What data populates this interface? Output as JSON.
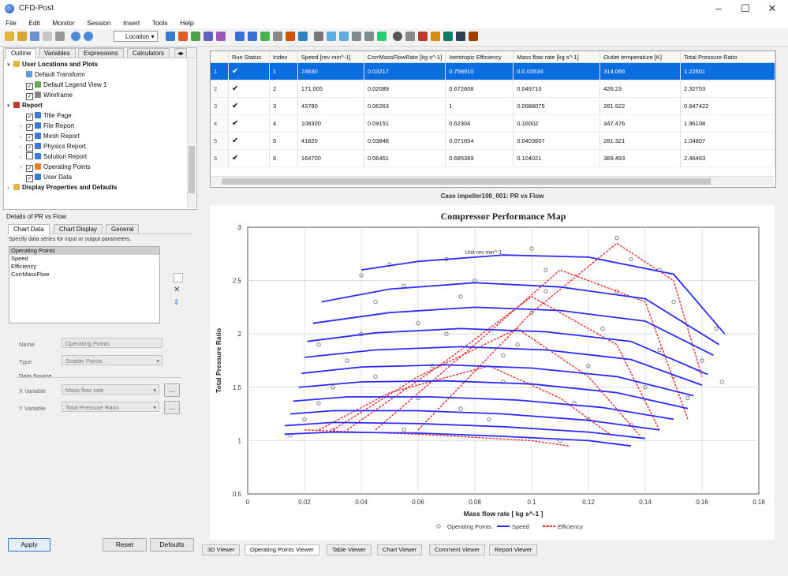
{
  "window": {
    "title": "CFD-Post",
    "controls": [
      "–",
      "☐",
      "✕"
    ]
  },
  "menu": [
    "File",
    "Edit",
    "Monitor",
    "Session",
    "Insert",
    "Tools",
    "Help"
  ],
  "toolbar": {
    "location_label": "Location"
  },
  "outline": {
    "tabs": [
      "Outline",
      "Variables",
      "Expressions",
      "Calculators"
    ],
    "items": [
      {
        "label": "User Locations and Plots",
        "level": 0,
        "bold": true,
        "expander": "▾",
        "icon": "folder-icon"
      },
      {
        "label": "Default Transform",
        "level": 1,
        "icon": "transform-icon"
      },
      {
        "label": "Default Legend View 1",
        "level": 1,
        "icon": "legend-icon",
        "checkbox": true
      },
      {
        "label": "Wireframe",
        "level": 1,
        "icon": "wireframe-icon",
        "checkbox": true
      },
      {
        "label": "Report",
        "level": 0,
        "bold": true,
        "expander": "▾",
        "icon": "report-icon"
      },
      {
        "label": "Title Page",
        "level": 1,
        "icon": "page-icon",
        "checkbox": true
      },
      {
        "label": "File Report",
        "level": 1,
        "icon": "page-icon",
        "checkbox": true,
        "expander": "›"
      },
      {
        "label": "Mesh Report",
        "level": 1,
        "icon": "page-icon",
        "checkbox": true,
        "expander": "›"
      },
      {
        "label": "Physics Report",
        "level": 1,
        "icon": "page-icon",
        "checkbox": true,
        "expander": "›"
      },
      {
        "label": "Solution Report",
        "level": 1,
        "icon": "page-icon",
        "checkbox": false,
        "expander": "›"
      },
      {
        "label": "Operating Points",
        "level": 1,
        "icon": "chart-icon",
        "checkbox": true,
        "expander": "›"
      },
      {
        "label": "User Data",
        "level": 1,
        "icon": "page-icon",
        "checkbox": true
      },
      {
        "label": "Display Properties and Defaults",
        "level": 0,
        "bold": true,
        "expander": "›",
        "icon": "folder-icon"
      }
    ]
  },
  "details": {
    "header": "Details of PR vs Flow",
    "tabs": [
      "Chart Data",
      "Chart Display",
      "General"
    ],
    "instruction": "Specify data series for input or output parameters.",
    "series_list": [
      "Operating Points",
      "Speed",
      "Efficiency",
      "CorrMassFlow"
    ],
    "name_label": "Name",
    "name_value": "Operating Points",
    "type_label": "Type",
    "type_value": "Scatter Points",
    "data_source_label": "Data Source",
    "xvar_label": "X Variable",
    "xvar_value": "Mass flow rate",
    "yvar_label": "Y Variable",
    "yvar_value": "Total Pressure Ratio",
    "more_button": "...",
    "buttons": {
      "apply": "Apply",
      "reset": "Reset",
      "defaults": "Defaults"
    }
  },
  "table": {
    "columns": [
      "",
      "Run Status",
      "Index",
      "Speed [rev min^-1]",
      "CorrMassFlowRate [kg s^-1]",
      "Isentropic Efficiency",
      "Mass flow rate [kg s^-1]",
      "Outlet temperature [K]",
      "Total Pressure Ratio"
    ],
    "rows": [
      {
        "n": "1",
        "status": "✔",
        "index": "1",
        "speed": "74630",
        "corr": "0.03217",
        "eff": "0.758910",
        "mfr": "0.0.03534",
        "temp": "314.066",
        "tpr": "1.22601"
      },
      {
        "n": "2",
        "status": "✔",
        "index": "2",
        "speed": "171,005",
        "corr": "0.02089",
        "eff": "0.672608",
        "mfr": "0.049710",
        "temp": "426.23",
        "tpr": "2.32753"
      },
      {
        "n": "3",
        "status": "✔",
        "index": "3",
        "speed": "43780",
        "corr": "0.06263",
        "eff": "1",
        "mfr": "0.0688075",
        "temp": "281.922",
        "tpr": "0.947422"
      },
      {
        "n": "4",
        "status": "✔",
        "index": "4",
        "speed": "108300",
        "corr": "0.09151",
        "eff": "0.62304",
        "mfr": "0.16002",
        "temp": "347.476",
        "tpr": "1.96108"
      },
      {
        "n": "5",
        "status": "✔",
        "index": "5",
        "speed": "41820",
        "corr": "0.03848",
        "eff": "0.071654",
        "mfr": "0.0403607",
        "temp": "281.321",
        "tpr": "1.04807"
      },
      {
        "n": "6",
        "status": "✔",
        "index": "6",
        "speed": "164700",
        "corr": "0.06451",
        "eff": "0.685389",
        "mfr": "0.104021",
        "temp": "369.493",
        "tpr": "2.46463"
      }
    ]
  },
  "chart_caption": "Case impeller100_001: PR vs Flow",
  "chart_data": {
    "type": "line",
    "title": "Compressor Performance Map",
    "xlabel": "Mass flow rate [ kg s^-1 ]",
    "ylabel": "Total Pressure Ratio",
    "xlim": [
      0,
      0.18
    ],
    "ylim": [
      0.5,
      3
    ],
    "xticks": [
      "0",
      "0.02",
      "0.04",
      "0.06",
      "0.08",
      "0.1",
      "0.12",
      "0.14",
      "0.16",
      "0.18"
    ],
    "yticks": [
      "0.5",
      "1",
      "1.5",
      "2",
      "2.5",
      "3"
    ],
    "annotation": "Unit rev min^-1",
    "grid": true,
    "legend_position": "bottom",
    "legend": [
      {
        "name": "Operating Points",
        "color": "#888888"
      },
      {
        "name": "Speed",
        "color": "#2b2bff"
      },
      {
        "name": "Efficiency",
        "color": "#ee2222"
      }
    ],
    "speed_lines": [
      {
        "x": [
          0.013,
          0.03,
          0.06,
          0.09,
          0.12,
          0.135
        ],
        "y": [
          1.06,
          1.08,
          1.07,
          1.04,
          1.0,
          0.95
        ]
      },
      {
        "x": [
          0.013,
          0.03,
          0.06,
          0.09,
          0.12,
          0.14
        ],
        "y": [
          1.14,
          1.17,
          1.16,
          1.13,
          1.08,
          1.02
        ]
      },
      {
        "x": [
          0.015,
          0.03,
          0.06,
          0.09,
          0.12,
          0.145
        ],
        "y": [
          1.25,
          1.28,
          1.28,
          1.25,
          1.19,
          1.1
        ]
      },
      {
        "x": [
          0.016,
          0.035,
          0.065,
          0.095,
          0.125,
          0.15
        ],
        "y": [
          1.37,
          1.41,
          1.41,
          1.38,
          1.31,
          1.2
        ]
      },
      {
        "x": [
          0.018,
          0.04,
          0.07,
          0.1,
          0.13,
          0.155
        ],
        "y": [
          1.5,
          1.55,
          1.56,
          1.53,
          1.45,
          1.3
        ]
      },
      {
        "x": [
          0.019,
          0.04,
          0.07,
          0.1,
          0.13,
          0.157
        ],
        "y": [
          1.63,
          1.69,
          1.71,
          1.68,
          1.6,
          1.42
        ]
      },
      {
        "x": [
          0.02,
          0.045,
          0.075,
          0.105,
          0.135,
          0.16
        ],
        "y": [
          1.78,
          1.85,
          1.88,
          1.85,
          1.76,
          1.52
        ]
      },
      {
        "x": [
          0.021,
          0.045,
          0.075,
          0.105,
          0.135,
          0.162
        ],
        "y": [
          1.93,
          2.01,
          2.05,
          2.02,
          1.93,
          1.62
        ]
      },
      {
        "x": [
          0.023,
          0.05,
          0.08,
          0.11,
          0.14,
          0.164
        ],
        "y": [
          2.1,
          2.2,
          2.25,
          2.22,
          2.12,
          1.8
        ]
      },
      {
        "x": [
          0.026,
          0.05,
          0.08,
          0.11,
          0.14,
          0.166
        ],
        "y": [
          2.3,
          2.42,
          2.48,
          2.44,
          2.33,
          1.9
        ]
      },
      {
        "x": [
          0.04,
          0.06,
          0.09,
          0.12,
          0.15,
          0.168
        ],
        "y": [
          2.6,
          2.68,
          2.74,
          2.72,
          2.56,
          2.0
        ]
      }
    ],
    "efficiency_lines": [
      {
        "x": [
          0.02,
          0.06,
          0.1,
          0.113
        ],
        "y": [
          1.1,
          1.06,
          1.0,
          0.95
        ]
      },
      {
        "x": [
          0.025,
          0.05,
          0.085,
          0.11,
          0.128
        ],
        "y": [
          1.1,
          1.45,
          1.7,
          1.4,
          1.05
        ]
      },
      {
        "x": [
          0.03,
          0.06,
          0.095,
          0.12,
          0.138
        ],
        "y": [
          1.1,
          1.6,
          2.05,
          1.6,
          1.05
        ]
      },
      {
        "x": [
          0.035,
          0.07,
          0.1,
          0.13,
          0.145
        ],
        "y": [
          1.1,
          1.75,
          2.35,
          1.9,
          1.1
        ]
      },
      {
        "x": [
          0.045,
          0.08,
          0.11,
          0.14,
          0.155
        ],
        "y": [
          1.1,
          1.9,
          2.6,
          2.3,
          1.2
        ]
      },
      {
        "x": [
          0.06,
          0.1,
          0.13,
          0.15,
          0.16
        ],
        "y": [
          1.1,
          2.2,
          2.85,
          2.5,
          1.6
        ]
      }
    ],
    "operating_points": [
      [
        0.015,
        1.05
      ],
      [
        0.02,
        1.2
      ],
      [
        0.025,
        1.35
      ],
      [
        0.03,
        1.5
      ],
      [
        0.035,
        1.75
      ],
      [
        0.04,
        2.0
      ],
      [
        0.045,
        2.3
      ],
      [
        0.05,
        2.65
      ],
      [
        0.055,
        1.1
      ],
      [
        0.06,
        1.4
      ],
      [
        0.065,
        1.7
      ],
      [
        0.07,
        2.0
      ],
      [
        0.075,
        2.35
      ],
      [
        0.08,
        2.5
      ],
      [
        0.085,
        1.2
      ],
      [
        0.09,
        1.55
      ],
      [
        0.095,
        1.9
      ],
      [
        0.1,
        2.2
      ],
      [
        0.105,
        2.6
      ],
      [
        0.11,
        1.0
      ],
      [
        0.115,
        1.35
      ],
      [
        0.12,
        1.7
      ],
      [
        0.125,
        2.05
      ],
      [
        0.13,
        2.4
      ],
      [
        0.135,
        1.15
      ],
      [
        0.14,
        1.5
      ],
      [
        0.145,
        1.85
      ],
      [
        0.15,
        2.3
      ],
      [
        0.155,
        1.4
      ],
      [
        0.16,
        1.75
      ],
      [
        0.165,
        2.05
      ],
      [
        0.167,
        1.55
      ],
      [
        0.03,
        1.1
      ],
      [
        0.045,
        1.6
      ],
      [
        0.06,
        2.1
      ],
      [
        0.075,
        1.3
      ],
      [
        0.09,
        1.8
      ],
      [
        0.105,
        2.4
      ],
      [
        0.12,
        1.2
      ],
      [
        0.135,
        2.7
      ],
      [
        0.15,
        1.6
      ],
      [
        0.04,
        2.55
      ],
      [
        0.07,
        2.7
      ],
      [
        0.1,
        2.8
      ],
      [
        0.13,
        2.9
      ],
      [
        0.145,
        2.6
      ],
      [
        0.025,
        1.9
      ],
      [
        0.055,
        2.45
      ]
    ]
  },
  "bottom_tabs": [
    "3D Viewer",
    "Operating Points Viewer",
    "Table Viewer",
    "Chart Viewer",
    "Comment Viewer",
    "Report Viewer"
  ]
}
